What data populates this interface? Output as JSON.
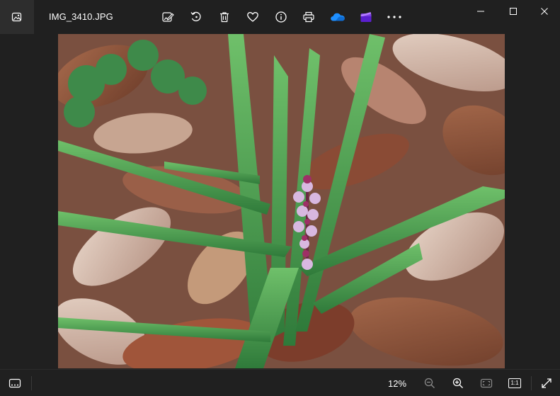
{
  "title_bar": {
    "file_name": "IMG_3410.JPG",
    "app_icon": "photos-app-icon"
  },
  "toolbar": {
    "items": [
      {
        "icon": "edit-image-icon"
      },
      {
        "icon": "rotate-icon"
      },
      {
        "icon": "delete-icon"
      },
      {
        "icon": "heart-icon"
      },
      {
        "icon": "info-icon"
      },
      {
        "icon": "print-icon"
      },
      {
        "icon": "onedrive-icon",
        "color": "#1e8fff"
      },
      {
        "icon": "clipchamp-icon",
        "color": "#7b3fe4"
      },
      {
        "icon": "more-options-icon"
      }
    ]
  },
  "window_controls": {
    "minimize_icon": "minimize-icon",
    "maximize_icon": "maximize-icon",
    "close_icon": "close-icon"
  },
  "bottom_bar": {
    "filmstrip_icon": "filmstrip-icon",
    "zoom_level": "12%",
    "zoom_out_icon": "zoom-out-icon",
    "zoom_in_icon": "zoom-in-icon",
    "fit_to_window_icon": "fit-to-window-icon",
    "actual_size_label": "1:1",
    "fullscreen_icon": "fullscreen-icon"
  },
  "colors": {
    "background": "#202020",
    "icon": "#ffffff",
    "icon_disabled": "#8a8a8a"
  }
}
